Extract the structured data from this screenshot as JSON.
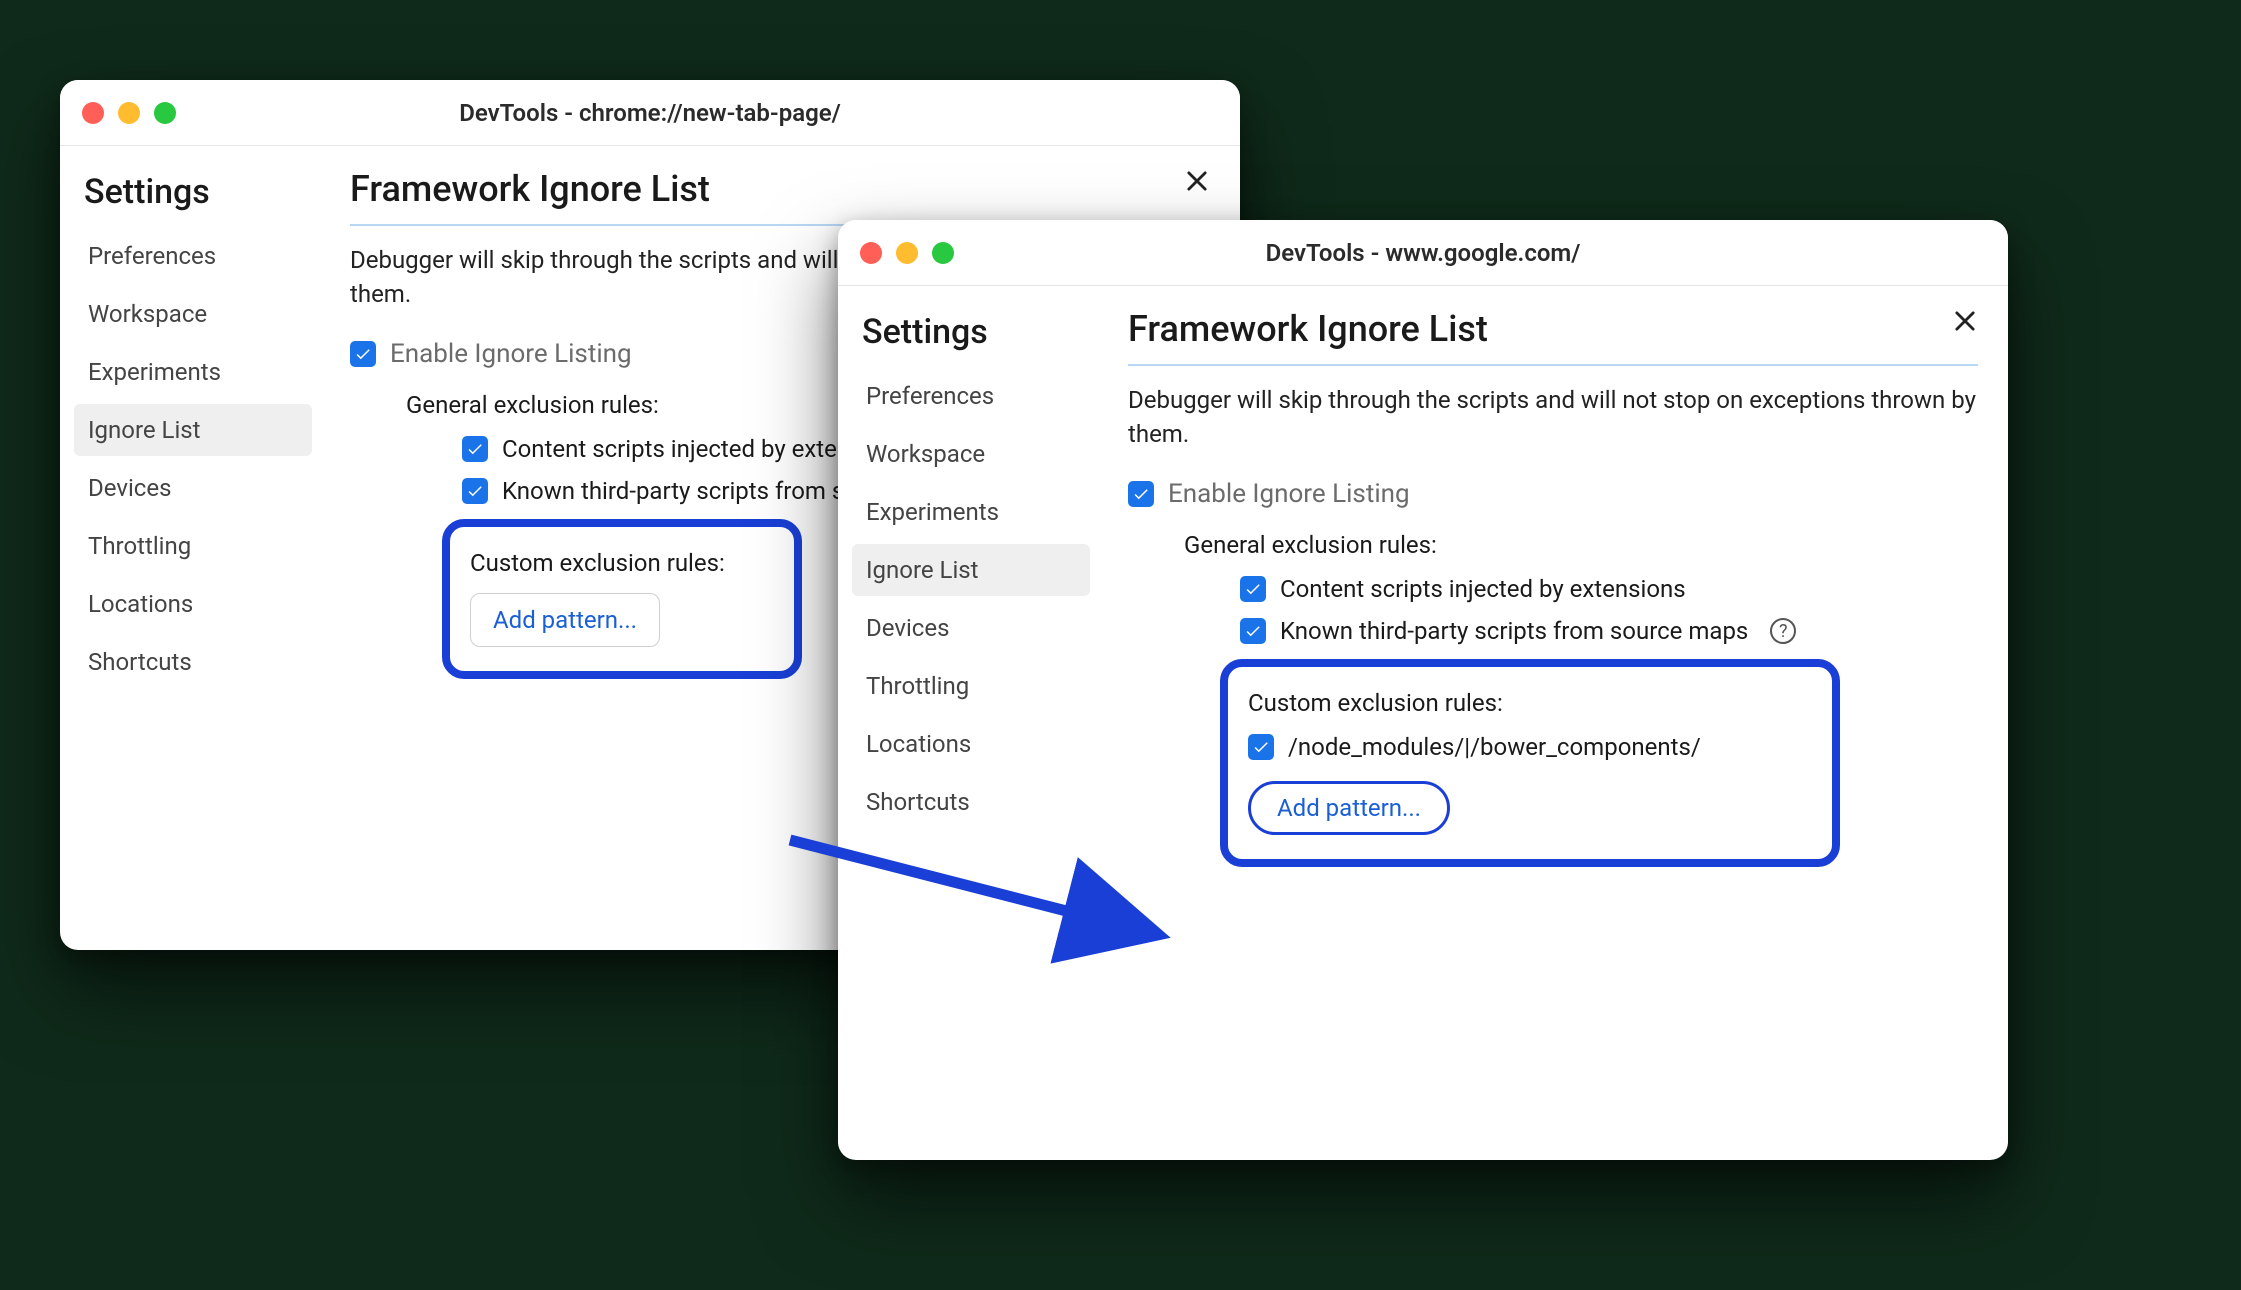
{
  "windows": {
    "left": {
      "title": "DevTools - chrome://new-tab-page/",
      "settings_heading": "Settings",
      "page_title": "Framework Ignore List",
      "description": "Debugger will skip through the scripts and will not stop on exceptions thrown by them.",
      "enable_label": "Enable Ignore Listing",
      "general_heading": "General exclusion rules:",
      "rule_content_scripts": "Content scripts injected by extensions",
      "rule_third_party": "Known third-party scripts from source maps",
      "custom_heading": "Custom exclusion rules:",
      "add_pattern_label": "Add pattern...",
      "nav": [
        "Preferences",
        "Workspace",
        "Experiments",
        "Ignore List",
        "Devices",
        "Throttling",
        "Locations",
        "Shortcuts"
      ],
      "nav_selected": "Ignore List"
    },
    "right": {
      "title": "DevTools - www.google.com/",
      "settings_heading": "Settings",
      "page_title": "Framework Ignore List",
      "description": "Debugger will skip through the scripts and will not stop on exceptions thrown by them.",
      "enable_label": "Enable Ignore Listing",
      "general_heading": "General exclusion rules:",
      "rule_content_scripts": "Content scripts injected by extensions",
      "rule_third_party": "Known third-party scripts from source maps",
      "custom_heading": "Custom exclusion rules:",
      "custom_pattern_1": "/node_modules/|/bower_components/",
      "add_pattern_label": "Add pattern...",
      "nav": [
        "Preferences",
        "Workspace",
        "Experiments",
        "Ignore List",
        "Devices",
        "Throttling",
        "Locations",
        "Shortcuts"
      ],
      "nav_selected": "Ignore List"
    }
  },
  "colors": {
    "accent": "#1a73e8",
    "callout_border": "#1a3fd6"
  }
}
